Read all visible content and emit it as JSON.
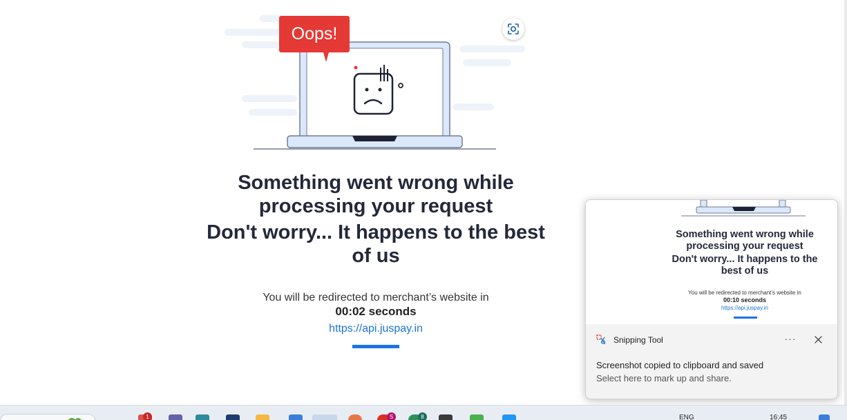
{
  "illustration": {
    "bubble_text": "Oops!",
    "bubble_color": "#e53935",
    "laptop_screen_color": "#ffffff",
    "laptop_frame_color": "#dbe8fb"
  },
  "headline": {
    "line1": "Something went wrong while processing your request",
    "line2": "Don't worry... It happens to the best of us"
  },
  "redirect": {
    "text": "You will be redirected to merchant’s website in",
    "countdown": "00:02 seconds",
    "link": "https://api.juspay.in",
    "accent_color": "#1a73e8"
  },
  "toast": {
    "app_name": "Snipping Tool",
    "more_label": "···",
    "title": "Screenshot copied to clipboard and saved",
    "subtitle": "Select here to mark up and share.",
    "preview": {
      "line1": "Something went wrong while processing your request",
      "line2": "Don't worry... It happens to the best of us",
      "redirect_text": "You will be redirected to merchant’s website in",
      "countdown": "00:10 seconds",
      "link": "https://api.juspay.in"
    }
  },
  "taskbar": {
    "badge_mail": "1",
    "badge_s": "S",
    "badge_8": "8",
    "language": "ENG",
    "time": "16:45"
  }
}
